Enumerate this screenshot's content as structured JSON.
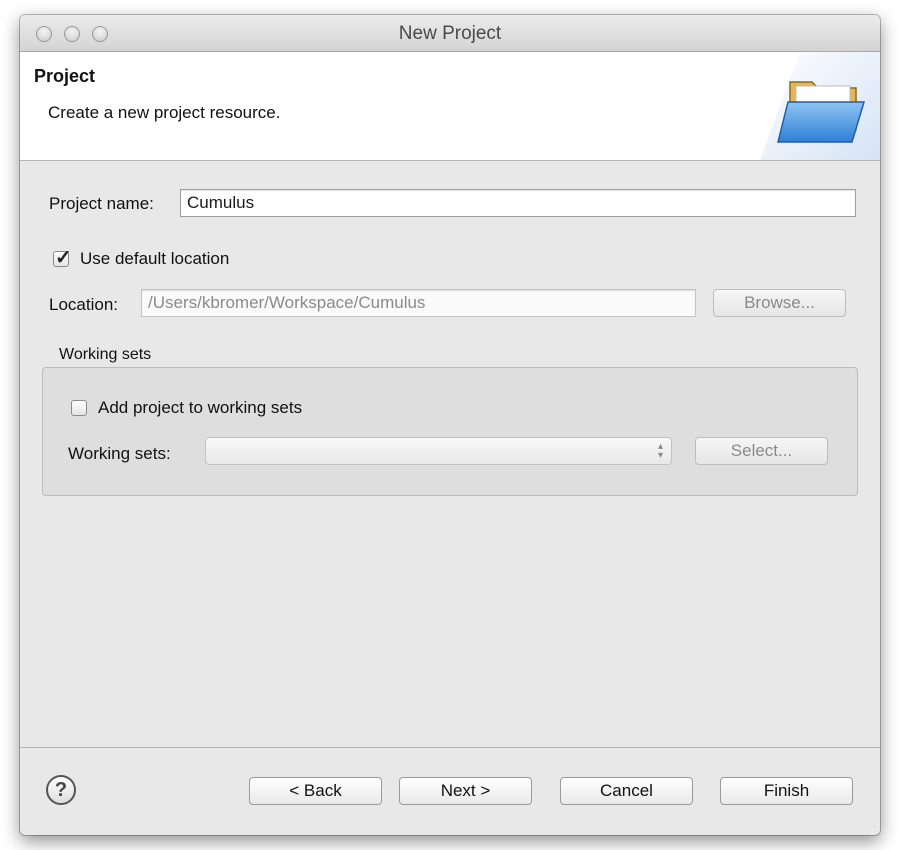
{
  "window": {
    "title": "New Project"
  },
  "banner": {
    "title": "Project",
    "subtitle": "Create a new project resource.",
    "icon": "folder-icon"
  },
  "form": {
    "project_name_label": "Project name:",
    "project_name_value": "Cumulus",
    "use_default_label": "Use default location",
    "use_default_checked": true,
    "location_label": "Location:",
    "location_value": "/Users/kbromer/Workspace/Cumulus",
    "browse_label": "Browse..."
  },
  "working_sets": {
    "group_label": "Working sets",
    "add_label": "Add project to working sets",
    "add_checked": false,
    "sets_label": "Working sets:",
    "sets_value": "",
    "select_label": "Select..."
  },
  "footer": {
    "help_icon": "help-icon",
    "back_label": "< Back",
    "next_label": "Next >",
    "cancel_label": "Cancel",
    "finish_label": "Finish"
  }
}
